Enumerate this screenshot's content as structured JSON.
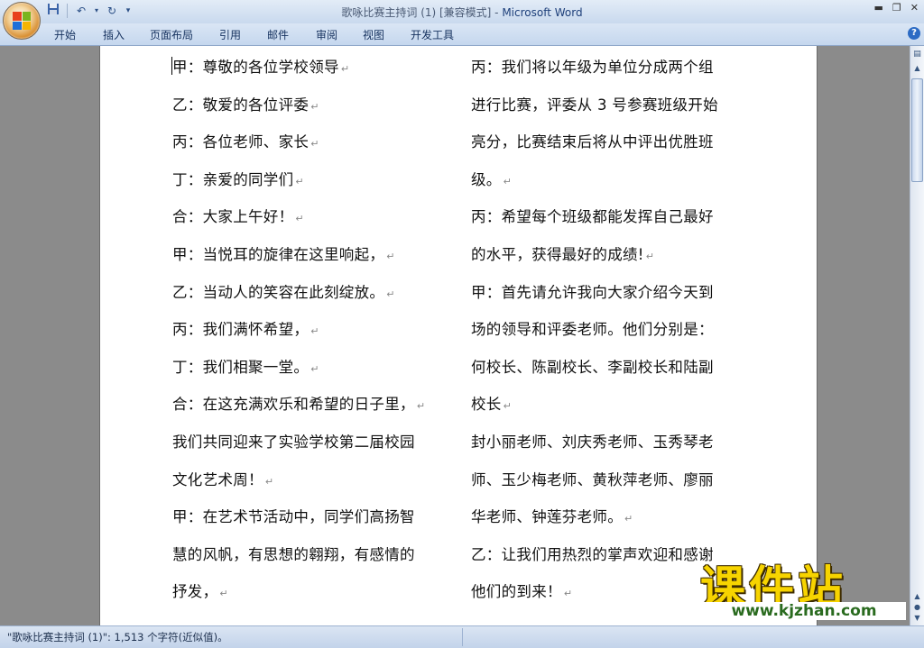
{
  "window": {
    "title_doc": "歌咏比赛主持词 (1) [兼容模式] - ",
    "title_app": "Microsoft Word"
  },
  "quick_access": {
    "save_icon": "save-icon",
    "undo_icon": "undo-icon",
    "redo_icon": "redo-icon",
    "customize_icon": "customize-icon"
  },
  "ribbon": {
    "tabs": [
      "开始",
      "插入",
      "页面布局",
      "引用",
      "邮件",
      "审阅",
      "视图",
      "开发工具"
    ]
  },
  "document": {
    "left_column": [
      "甲：尊敬的各位学校领导",
      "乙：敬爱的各位评委",
      "丙：各位老师、家长",
      "丁：亲爱的同学们",
      "合：大家上午好！",
      "甲：当悦耳的旋律在这里响起，",
      "乙：当动人的笑容在此刻绽放。",
      "丙：我们满怀希望，",
      "丁：我们相聚一堂。",
      "合：在这充满欢乐和希望的日子里，",
      "我们共同迎来了实验学校第二届校园",
      "文化艺术周！",
      "甲：在艺术节活动中，同学们高扬智",
      "慧的风帆，有思想的翱翔，有感情的",
      "抒发，"
    ],
    "right_column": [
      "丙：我们将以年级为单位分成两个组",
      "进行比赛，评委从 3 号参赛班级开始",
      "亮分，比赛结束后将从中评出优胜班",
      "级。",
      "丙：希望每个班级都能发挥自己最好",
      "的水平，获得最好的成绩!",
      "甲：首先请允许我向大家介绍今天到",
      "场的领导和评委老师。他们分别是：",
      "何校长、陈副校长、李副校长和陆副",
      "校长",
      "封小丽老师、刘庆秀老师、玉秀琴老",
      "师、玉少梅老师、黄秋萍老师、廖丽",
      "华老师、钟莲芬老师。",
      "乙：让我们用热烈的掌声欢迎和感谢",
      "他们的到来！"
    ],
    "left_marks": [
      true,
      true,
      true,
      true,
      true,
      true,
      true,
      true,
      true,
      true,
      false,
      true,
      false,
      false,
      true
    ],
    "right_marks": [
      false,
      false,
      false,
      true,
      false,
      true,
      false,
      false,
      false,
      true,
      false,
      false,
      true,
      false,
      true
    ]
  },
  "statusbar": {
    "text": "\"歌咏比赛主持词 (1)\": 1,513 个字符(近似值)。"
  },
  "watermark": {
    "title": "课件站",
    "url": "www.kjzhan.com"
  },
  "colors": {
    "watermark_yellow": "#f7d400",
    "watermark_green": "#2a6b1f",
    "office_orange": "#d78b2c"
  }
}
